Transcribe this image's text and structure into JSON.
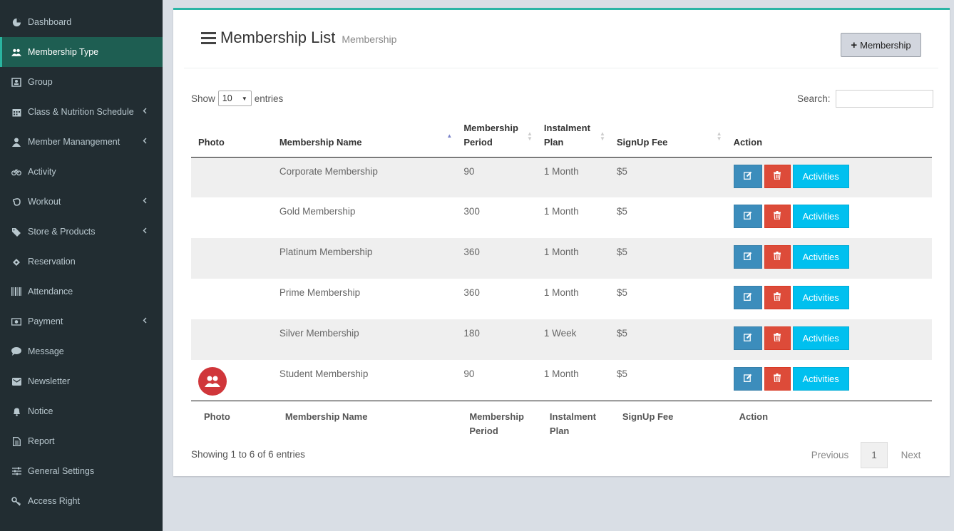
{
  "sidebar": {
    "items": [
      {
        "label": "Dashboard",
        "icon": "dashboard-icon",
        "has_submenu": false,
        "active": false
      },
      {
        "label": "Membership Type",
        "icon": "users-icon",
        "has_submenu": false,
        "active": true
      },
      {
        "label": "Group",
        "icon": "group-icon",
        "has_submenu": false,
        "active": false
      },
      {
        "label": "Class & Nutrition Schedule",
        "icon": "calendar-icon",
        "has_submenu": true,
        "active": false
      },
      {
        "label": "Member Manangement",
        "icon": "user-icon",
        "has_submenu": true,
        "active": false
      },
      {
        "label": "Activity",
        "icon": "bicycle-icon",
        "has_submenu": false,
        "active": false
      },
      {
        "label": "Workout",
        "icon": "hand-icon",
        "has_submenu": true,
        "active": false
      },
      {
        "label": "Store & Products",
        "icon": "tags-icon",
        "has_submenu": true,
        "active": false
      },
      {
        "label": "Reservation",
        "icon": "ticket-icon",
        "has_submenu": false,
        "active": false
      },
      {
        "label": "Attendance",
        "icon": "barcode-icon",
        "has_submenu": false,
        "active": false
      },
      {
        "label": "Payment",
        "icon": "money-icon",
        "has_submenu": true,
        "active": false
      },
      {
        "label": "Message",
        "icon": "comment-icon",
        "has_submenu": false,
        "active": false
      },
      {
        "label": "Newsletter",
        "icon": "envelope-icon",
        "has_submenu": false,
        "active": false
      },
      {
        "label": "Notice",
        "icon": "bell-icon",
        "has_submenu": false,
        "active": false
      },
      {
        "label": "Report",
        "icon": "file-icon",
        "has_submenu": false,
        "active": false
      },
      {
        "label": "General Settings",
        "icon": "sliders-icon",
        "has_submenu": false,
        "active": false
      },
      {
        "label": "Access Right",
        "icon": "key-icon",
        "has_submenu": false,
        "active": false
      }
    ]
  },
  "header": {
    "title": "Membership List",
    "subtitle": "Membership",
    "add_button_label": "Membership"
  },
  "controls": {
    "show_label": "Show",
    "entries_value": "10",
    "entries_label": "entries",
    "search_label": "Search:",
    "search_value": ""
  },
  "table": {
    "columns": [
      {
        "line1": "Photo",
        "line2": ""
      },
      {
        "line1": "Membership Name",
        "line2": ""
      },
      {
        "line1": "Membership",
        "line2": "Period"
      },
      {
        "line1": "Instalment",
        "line2": "Plan"
      },
      {
        "line1": "SignUp Fee",
        "line2": ""
      },
      {
        "line1": "Action",
        "line2": ""
      }
    ],
    "rows": [
      {
        "photo": false,
        "name": "Corporate Membership",
        "period": "90",
        "plan": "1 Month",
        "fee": "$5"
      },
      {
        "photo": false,
        "name": "Gold Membership",
        "period": "300",
        "plan": "1 Month",
        "fee": "$5"
      },
      {
        "photo": false,
        "name": "Platinum Membership",
        "period": "360",
        "plan": "1 Month",
        "fee": "$5"
      },
      {
        "photo": false,
        "name": "Prime Membership",
        "period": "360",
        "plan": "1 Month",
        "fee": "$5"
      },
      {
        "photo": false,
        "name": "Silver Membership",
        "period": "180",
        "plan": "1 Week",
        "fee": "$5"
      },
      {
        "photo": true,
        "name": "Student Membership",
        "period": "90",
        "plan": "1 Month",
        "fee": "$5"
      }
    ],
    "activities_label": "Activities"
  },
  "footer": {
    "info": "Showing 1 to 6 of 6 entries",
    "previous_label": "Previous",
    "current_page": "1",
    "next_label": "Next"
  },
  "colors": {
    "sidebar_bg": "#222d32",
    "sidebar_active": "#1e5e52",
    "panel_top_border": "#2bb5a5",
    "edit_button": "#3c8dbc",
    "delete_button": "#dd4b39",
    "activities_button": "#00c0ef",
    "avatar": "#d0363a"
  }
}
